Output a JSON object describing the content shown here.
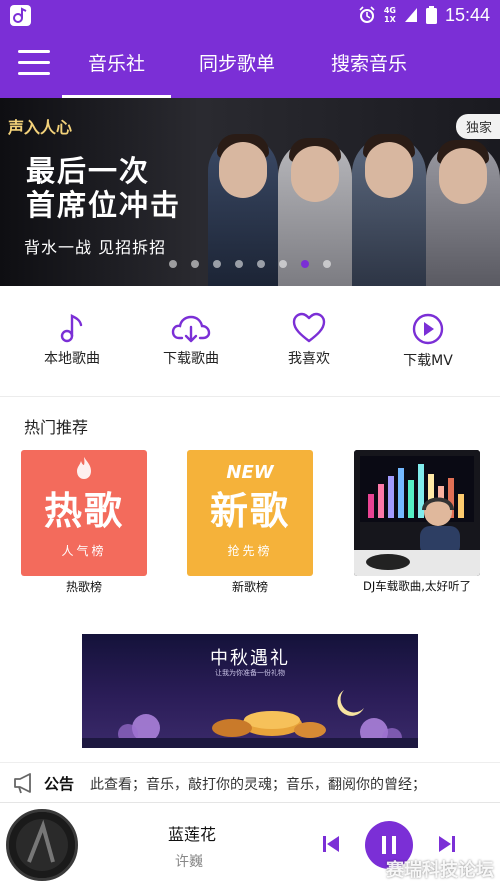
{
  "status_bar": {
    "time": "15:44",
    "network_top": "4G",
    "network_bottom": "1X"
  },
  "nav": {
    "tabs": [
      {
        "label": "音乐社",
        "active": true
      },
      {
        "label": "同步歌单",
        "active": false
      },
      {
        "label": "搜索音乐",
        "active": false
      }
    ],
    "accent": "#7b2fd6"
  },
  "banner": {
    "logo": "声入人心",
    "title_line1": "最后一次",
    "title_line2": "首席位冲击",
    "subtitle": "背水一战 见招拆招",
    "badge": "独家",
    "dot_count": 8,
    "active_dot": 6
  },
  "quick_actions": [
    {
      "label": "本地歌曲",
      "icon": "music-note-icon"
    },
    {
      "label": "下载歌曲",
      "icon": "cloud-download-icon"
    },
    {
      "label": "我喜欢",
      "icon": "heart-icon"
    },
    {
      "label": "下载MV",
      "icon": "play-circle-icon"
    }
  ],
  "hot": {
    "title": "热门推荐",
    "cards": [
      {
        "big": "热歌",
        "sub": "人气榜",
        "label": "热歌榜",
        "color": "#f36b5c"
      },
      {
        "big": "新歌",
        "sub": "抢先榜",
        "label": "新歌榜",
        "badge": "NEW",
        "color": "#f5b23a"
      },
      {
        "label": "DJ车载歌曲,太好听了",
        "color": "#1f1f24"
      }
    ]
  },
  "promo": {
    "title": "中秋遇礼",
    "subtitle": "让我为你准备一份礼物"
  },
  "notice": {
    "label": "公告",
    "text": "此查看；音乐，敲打你的灵魂；音乐，翻阅你的曾经；"
  },
  "player": {
    "song": "蓝莲花",
    "artist": "许巍",
    "watermark": "赛瑞科技论坛"
  }
}
